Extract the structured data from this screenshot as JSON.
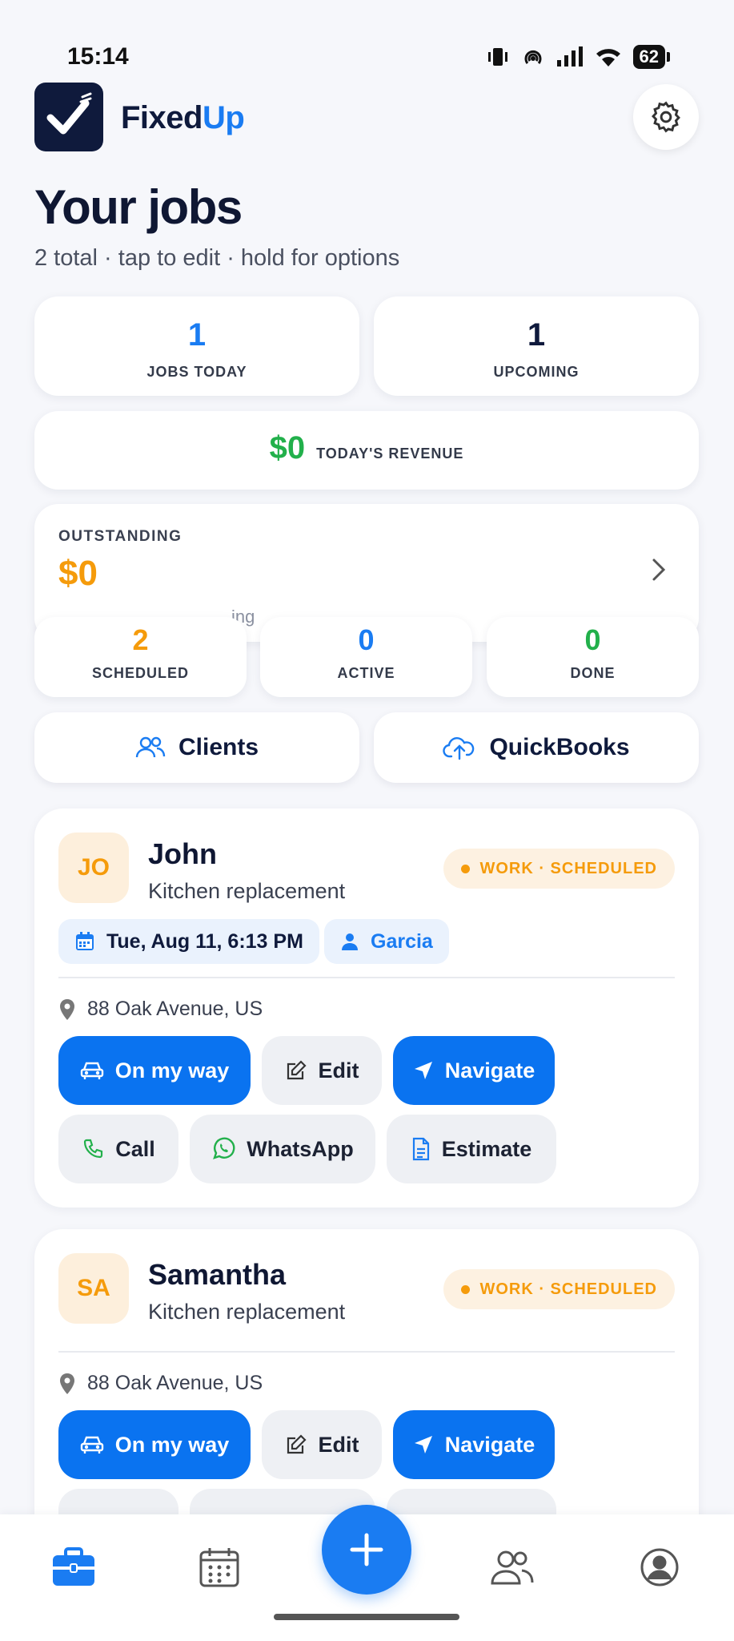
{
  "status_bar": {
    "time": "15:14",
    "battery": "62"
  },
  "app": {
    "name_part1": "Fixed",
    "name_part2": "Up"
  },
  "page": {
    "title": "Your jobs",
    "subtitle": "2 total · tap to edit · hold for options"
  },
  "stats": {
    "jobs_today": {
      "value": "1",
      "label": "JOBS TODAY"
    },
    "upcoming": {
      "value": "1",
      "label": "UPCOMING"
    }
  },
  "revenue": {
    "value": "$0",
    "label": "TODAY'S REVENUE"
  },
  "outstanding": {
    "label": "OUTSTANDING",
    "value": "$0",
    "peek_text": "ing"
  },
  "counts": {
    "scheduled": {
      "value": "2",
      "label": "SCHEDULED"
    },
    "active": {
      "value": "0",
      "label": "ACTIVE"
    },
    "done": {
      "value": "0",
      "label": "DONE"
    }
  },
  "quick_links": {
    "clients": "Clients",
    "quickbooks": "QuickBooks"
  },
  "jobs": [
    {
      "initials": "JO",
      "client": "John",
      "title": "Kitchen replacement",
      "status": "WORK · SCHEDULED",
      "date": "Tue, Aug 11, 6:13 PM",
      "tech": "Garcia",
      "address": "88 Oak Avenue, US",
      "actions": {
        "on_my_way": "On my way",
        "edit": "Edit",
        "navigate": "Navigate",
        "call": "Call",
        "whatsapp": "WhatsApp",
        "estimate": "Estimate"
      }
    },
    {
      "initials": "SA",
      "client": "Samantha",
      "title": "Kitchen replacement",
      "status": "WORK · SCHEDULED",
      "address": "88 Oak Avenue, US",
      "actions": {
        "on_my_way": "On my way",
        "edit": "Edit",
        "navigate": "Navigate"
      }
    }
  ],
  "colors": {
    "accent": "#1a7cf2",
    "navy": "#0f1a3c",
    "orange": "#f59b0b",
    "green": "#22b04b"
  },
  "nav": {
    "icons": [
      "briefcase-icon",
      "calendar-icon",
      "plus-icon",
      "users-icon",
      "profile-icon"
    ]
  }
}
